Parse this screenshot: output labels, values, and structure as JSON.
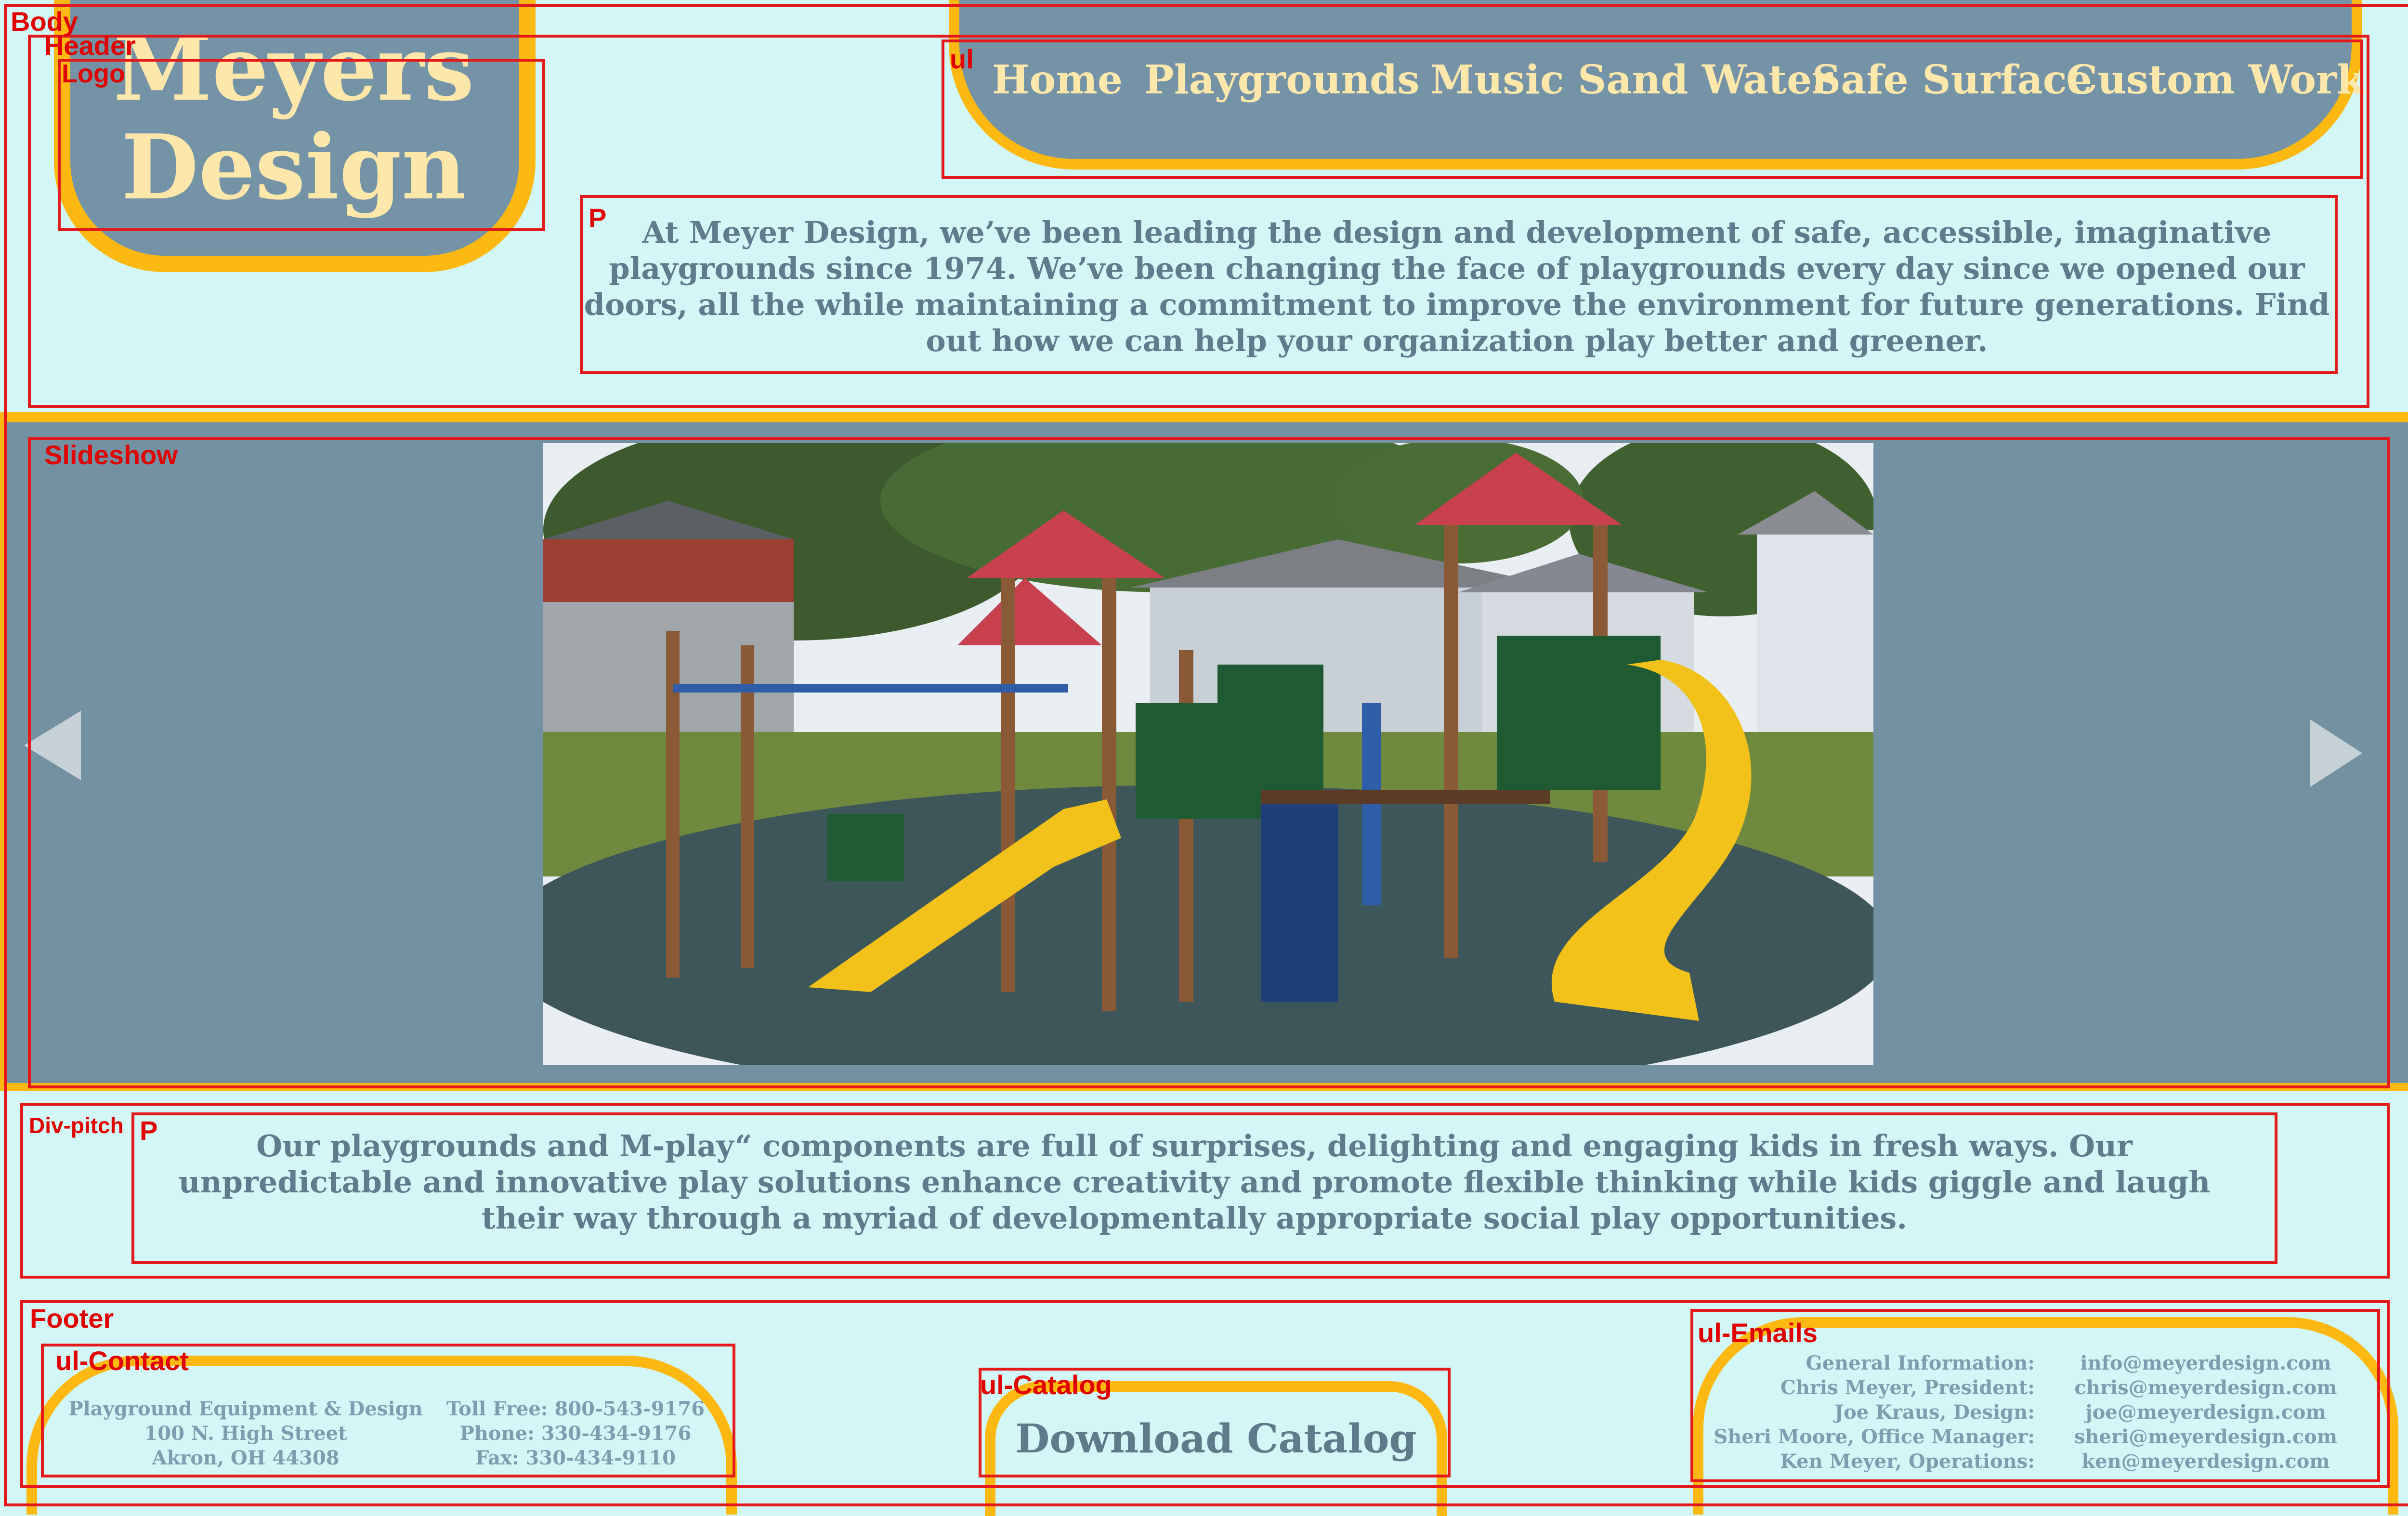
{
  "annotations": {
    "body": "Body",
    "header": "Header",
    "logo": "Logo",
    "nav": "ul",
    "intro": "P",
    "slideshow": "Slideshow",
    "pitch_div": "Div-pitch",
    "pitch_p": "P",
    "footer": "Footer",
    "contact": "ul-Contact",
    "catalog": "ul-Catalog",
    "emails": "ul-Emails"
  },
  "logo": {
    "line1": "Meyers",
    "line2": "Design"
  },
  "nav": {
    "items": [
      "Home",
      "Playgrounds",
      "Music Sand Water",
      "Safe Surface",
      "Custom Work"
    ]
  },
  "intro": {
    "text": "At Meyer Design, we’ve been leading the design and development of safe, accessible, imaginative playgrounds since 1974. We’ve been changing the face of playgrounds every day since we opened our doors, all the while maintaining a commitment to improve the environment for future generations. Find out how we can help your organization play better and greener."
  },
  "pitch": {
    "text": "Our playgrounds and M-play“ components are full of surprises, delighting and engaging kids in fresh ways. Our unpredictable and innovative play solutions enhance creativity and promote flexible thinking while kids giggle and laugh their way through a myriad of developmentally appropriate social play opportunities."
  },
  "contact": {
    "address": [
      "Playground Equipment & Design",
      "100 N. High Street",
      "Akron, OH 44308"
    ],
    "phones": [
      "Toll Free: 800-543-9176",
      "Phone: 330-434-9176",
      "Fax: 330-434-9110"
    ]
  },
  "catalog": {
    "label": "Download Catalog"
  },
  "emails": {
    "rows": [
      {
        "role": "General Information:",
        "email": "info@meyerdesign.com"
      },
      {
        "role": "Chris Meyer, President:",
        "email": "chris@meyerdesign.com"
      },
      {
        "role": "Joe Kraus, Design:",
        "email": "joe@meyerdesign.com"
      },
      {
        "role": "Sheri Moore, Office Manager:",
        "email": "sheri@meyerdesign.com"
      },
      {
        "role": "Ken Meyer, Operations:",
        "email": "ken@meyerdesign.com"
      }
    ]
  },
  "colors": {
    "background": "#d3f6f6",
    "panel": "#7493a6",
    "accent": "#fdb812",
    "cream_text": "#fde7ab",
    "body_text": "#607b8e",
    "annotation": "#e41a1a"
  }
}
